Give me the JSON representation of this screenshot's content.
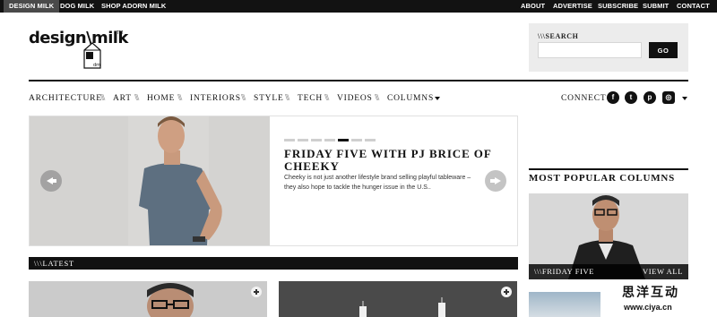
{
  "topbar": {
    "left_links": [
      "DESIGN MILK",
      "DOG MILK",
      "SHOP ADORN MILK"
    ],
    "right_links": [
      "ABOUT",
      "ADVERTISE",
      "SUBSCRIBE",
      "SUBMIT",
      "CONTACT"
    ]
  },
  "logo": {
    "text": "design\\milk",
    "tm": "TM",
    "carton_text": "dm"
  },
  "search": {
    "label": "\\\\\\SEARCH",
    "placeholder": "",
    "button": "GO"
  },
  "nav": {
    "items": [
      "ARCHITECTURE",
      "ART",
      "HOME",
      "INTERIORS",
      "STYLE",
      "TECH",
      "VIDEOS",
      "COLUMNS"
    ],
    "separator": "\\\\\\",
    "connect_label": "CONNECT",
    "social_icons": [
      "facebook-icon",
      "twitter-icon",
      "pinterest-icon",
      "instagram-icon"
    ],
    "social_glyphs": [
      "f",
      "t",
      "p",
      "◎"
    ]
  },
  "slider": {
    "title": "FRIDAY FIVE WITH PJ BRICE OF CHEEKY",
    "excerpt": "Cheeky is not just another lifestyle brand selling playful tableware – they also hope to tackle the hunger issue in the U.S..",
    "dots_total": 7,
    "active_dot": 5
  },
  "latest": {
    "label": "\\\\\\LATEST"
  },
  "sidebar": {
    "popular_title": "MOST POPULAR COLUMNS",
    "card_label": "\\\\\\FRIDAY FIVE",
    "view_all": "VIEW ALL"
  },
  "watermark": {
    "chinese": "思洋互动",
    "url": "www.ciya.cn"
  },
  "colors": {
    "bar": "#121212",
    "active_tab": "#4a4a4a",
    "search_bg": "#ececec"
  }
}
